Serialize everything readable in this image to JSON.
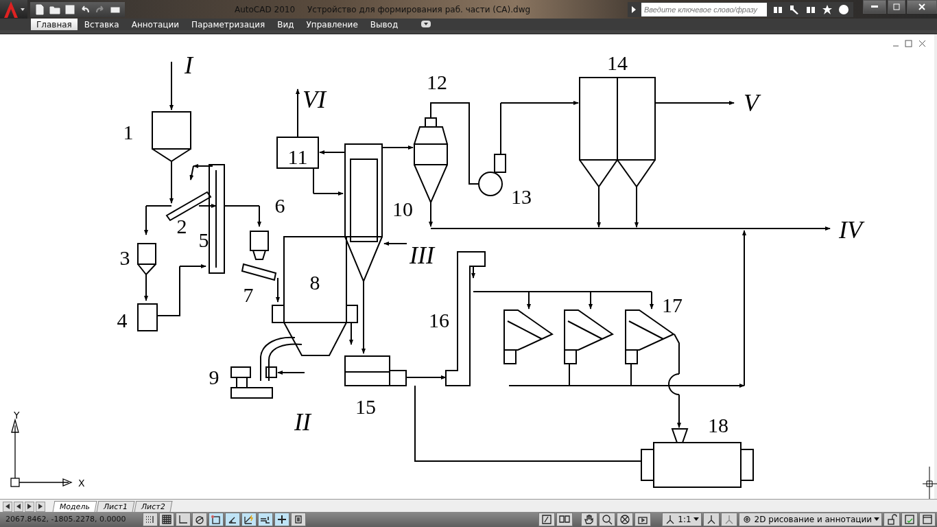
{
  "window": {
    "app": "AutoCAD 2010",
    "title": "Устройство для формирования раб. части (CA).dwg"
  },
  "search": {
    "placeholder": "Введите ключевое слово/фразу"
  },
  "ribbon_tabs": [
    {
      "label": "Главная",
      "selected": true
    },
    {
      "label": "Вставка",
      "selected": false
    },
    {
      "label": "Аннотации",
      "selected": false
    },
    {
      "label": "Параметризация",
      "selected": false
    },
    {
      "label": "Вид",
      "selected": false
    },
    {
      "label": "Управление",
      "selected": false
    },
    {
      "label": "Вывод",
      "selected": false
    }
  ],
  "drawing": {
    "numbers": [
      "1",
      "2",
      "3",
      "4",
      "5",
      "6",
      "7",
      "8",
      "9",
      "10",
      "11",
      "12",
      "13",
      "14",
      "15",
      "16",
      "17",
      "18"
    ],
    "streams": [
      "I",
      "II",
      "III",
      "IV",
      "V",
      "VI"
    ],
    "ucs": {
      "x": "X",
      "y": "Y"
    }
  },
  "layout_tabs": [
    {
      "label": "Модель",
      "selected": true
    },
    {
      "label": "Лист1",
      "selected": false
    },
    {
      "label": "Лист2",
      "selected": false
    }
  ],
  "status_bar": {
    "coordinates": "2067.8462, -1805.2278, 0.0000",
    "toggles": [
      {
        "kind": "snap",
        "on": false
      },
      {
        "kind": "grid",
        "on": false
      },
      {
        "kind": "ortho",
        "on": false
      },
      {
        "kind": "polar",
        "on": false
      },
      {
        "kind": "osnap",
        "on": true
      },
      {
        "kind": "otrack",
        "on": true
      },
      {
        "kind": "dyn",
        "on": true
      },
      {
        "kind": "lwt",
        "on": true
      },
      {
        "kind": "cross",
        "on": true
      },
      {
        "kind": "qp",
        "on": false
      }
    ],
    "scale": "1:1",
    "workspace": "2D рисование и аннотации"
  }
}
